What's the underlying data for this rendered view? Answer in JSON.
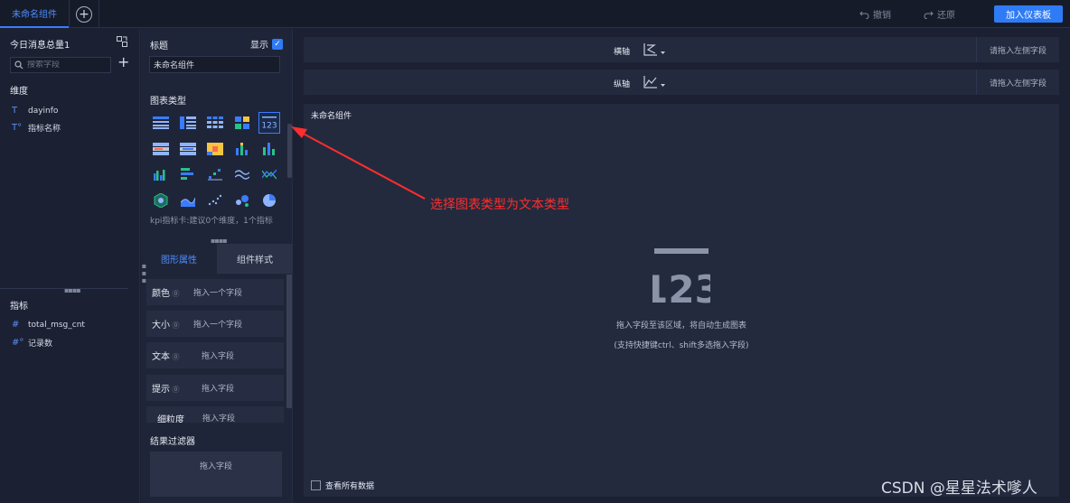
{
  "topbar": {
    "active_tab": "未命名组件",
    "add_icon": "plus-circle-icon",
    "undo": {
      "label": "撤销",
      "icon": "undo-icon"
    },
    "redo": {
      "label": "还原",
      "icon": "redo-icon"
    },
    "publish": "加入仪表板"
  },
  "data_panel": {
    "dataset": "今日消息总量1",
    "search_placeholder": "搜索字段",
    "dimensions_title": "维度",
    "dimensions": [
      {
        "icon": "T",
        "label": "dayinfo"
      },
      {
        "icon": "T°",
        "label": "指标名称"
      }
    ],
    "measures_title": "指标",
    "measures": [
      {
        "icon": "#",
        "label": "total_msg_cnt"
      },
      {
        "icon": "#°",
        "label": "记录数"
      }
    ]
  },
  "config": {
    "title_label": "标题",
    "show_label": "显示",
    "show_checked": true,
    "title_value": "未命名组件",
    "chart_types_title": "图表类型",
    "selected_type_index": 4,
    "type_hint": "kpi指标卡:建议0个维度，1个指标",
    "tabs": [
      "图形属性",
      "组件样式"
    ],
    "properties": [
      {
        "label": "颜色",
        "drop": "拖入一个字段"
      },
      {
        "label": "大小",
        "drop": "拖入一个字段"
      },
      {
        "label": "文本",
        "drop": "拖入字段"
      },
      {
        "label": "提示",
        "drop": "拖入字段"
      },
      {
        "label": "细粒度",
        "drop": "拖入字段"
      }
    ],
    "filter_title": "结果过滤器",
    "filter_drop": "拖入字段"
  },
  "canvas": {
    "x_axis": {
      "label": "横轴",
      "hint": "请拖入左侧字段"
    },
    "y_axis": {
      "label": "纵轴",
      "hint": "请拖入左侧字段"
    },
    "title": "未命名组件",
    "empty_glyph": "123",
    "empty_line1": "拖入字段至该区域，将自动生成图表",
    "empty_line2": "(支持快捷键ctrl、shift多选拖入字段)",
    "view_all": "查看所有数据"
  },
  "annotation": "选择图表类型为文本类型",
  "watermark": "CSDN @星星法术嗲人",
  "colors": {
    "accent": "#2f7bf5",
    "annotation": "#ff2d2d",
    "background": "#1b2133"
  }
}
